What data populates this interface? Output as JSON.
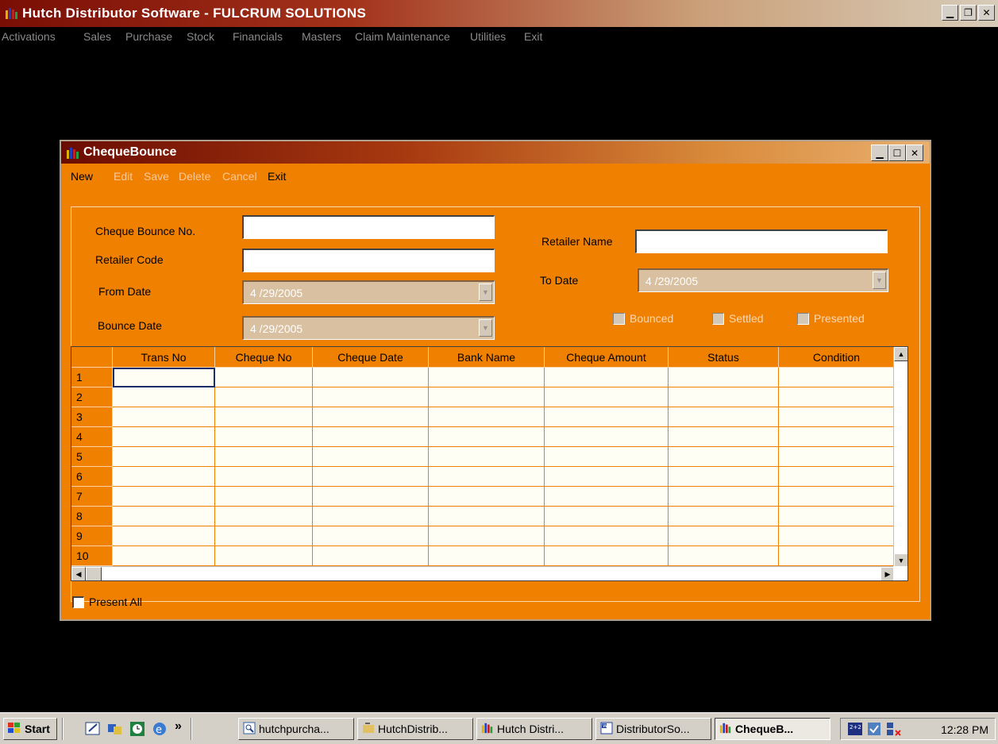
{
  "app": {
    "title": "Hutch Distributor Software - FULCRUM SOLUTIONS",
    "menu": [
      "Activations",
      "Sales",
      "Purchase",
      "Stock",
      "Financials",
      "Masters",
      "Claim Maintenance",
      "Utilities",
      "Exit"
    ]
  },
  "window": {
    "title": "ChequeBounce",
    "menu": [
      "New",
      "Edit",
      "Save",
      "Delete",
      "Cancel",
      "Exit"
    ]
  },
  "form": {
    "cheque_bounce_no_label": "Cheque Bounce No.",
    "cheque_bounce_no_value": "",
    "retailer_code_label": "Retailer Code",
    "retailer_code_value": "",
    "from_date_label": "From Date",
    "from_date_value": "4 /29/2005",
    "bounce_date_label": "Bounce Date",
    "bounce_date_value": "4 /29/2005",
    "retailer_name_label": "Retailer Name",
    "retailer_name_value": "",
    "to_date_label": "To Date",
    "to_date_value": "4 /29/2005",
    "bounced_label": "Bounced",
    "settled_label": "Settled",
    "presented_label": "Presented",
    "present_all_label": "Present All"
  },
  "grid": {
    "columns": [
      "Trans No",
      "Cheque No",
      "Cheque Date",
      "Bank Name",
      "Cheque Amount",
      "Status",
      "Condition"
    ],
    "rows": [
      "1",
      "2",
      "3",
      "4",
      "5",
      "6",
      "7",
      "8",
      "9",
      "10"
    ]
  },
  "taskbar": {
    "start_label": "Start",
    "chevron": "»",
    "items": [
      "hutchpurcha...",
      "HutchDistrib...",
      "Hutch Distri...",
      "DistributorSo...",
      "ChequeB..."
    ],
    "clock": "12:28 PM"
  },
  "colors": {
    "form_background": "#f08000",
    "desktop": "#000000",
    "title_gradient_start": "#7a0e05"
  }
}
